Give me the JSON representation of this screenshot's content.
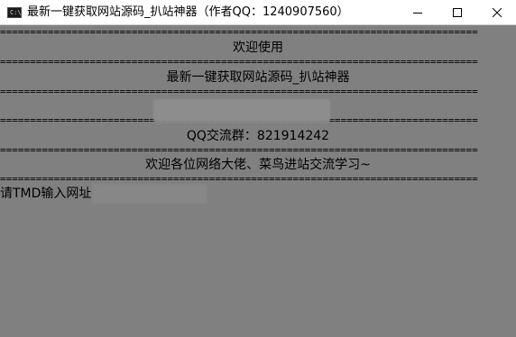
{
  "window": {
    "title": "最新一键获取网站源码_扒站神器（作者QQ：1240907560）",
    "icon_label": "C:\\",
    "background_color": "#808080",
    "text_color": "#000000"
  },
  "controls": {
    "minimize_icon": "minimize-icon",
    "maximize_icon": "maximize-icon",
    "close_icon": "close-icon"
  },
  "console": {
    "rule": "================================================================================",
    "line_welcome": "欢迎使用",
    "line_title": "最新一键获取网站源码_扒站神器",
    "line_qq_group": "QQ交流群：821914242",
    "line_greeting": "欢迎各位网络大佬、菜鸟进站交流学习~",
    "prompt": "请TMD输入网址"
  }
}
